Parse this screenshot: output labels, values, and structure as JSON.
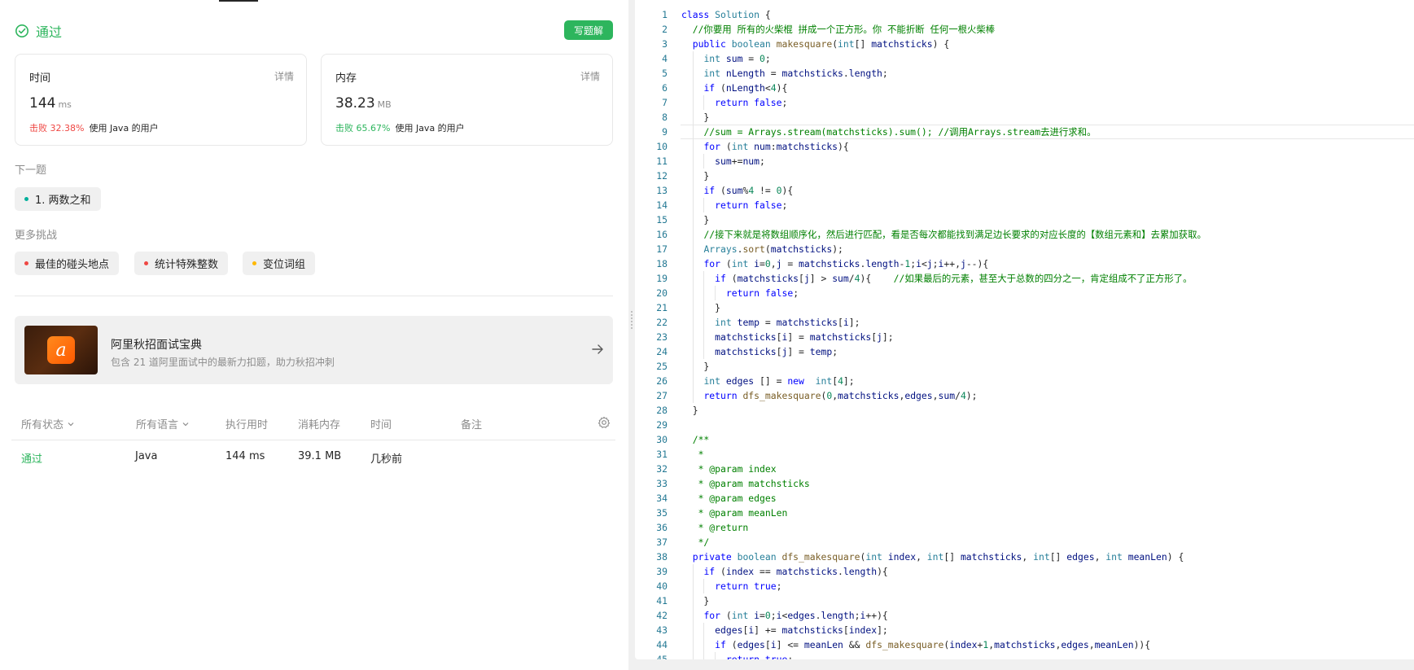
{
  "status": {
    "label": "通过",
    "write_solution": "写题解"
  },
  "cards": {
    "time": {
      "title": "时间",
      "detail": "详情",
      "value": "144",
      "unit": "ms",
      "beat": "击败 32.38%",
      "beat_suffix": "使用 Java 的用户"
    },
    "memory": {
      "title": "内存",
      "detail": "详情",
      "value": "38.23",
      "unit": "MB",
      "beat": "击败 65.67%",
      "beat_suffix": "使用 Java 的用户"
    }
  },
  "next": {
    "label": "下一题",
    "item": "1. 两数之和",
    "dot_color": "#00af9b"
  },
  "more": {
    "label": "更多挑战",
    "items": [
      {
        "label": "最佳的碰头地点",
        "dot_color": "#ef4743"
      },
      {
        "label": "统计特殊整数",
        "dot_color": "#ef4743"
      },
      {
        "label": "变位词组",
        "dot_color": "#ffb800"
      }
    ]
  },
  "promo": {
    "title": "阿里秋招面试宝典",
    "desc": "包含 21 道阿里面试中的最新力扣题，助力秋招冲刺"
  },
  "table": {
    "headers": [
      "所有状态",
      "所有语言",
      "执行用时",
      "消耗内存",
      "时间",
      "备注"
    ],
    "rows": [
      {
        "status": "通过",
        "lang": "Java",
        "runtime": "144 ms",
        "memory": "39.1 MB",
        "time": "几秒前",
        "note": ""
      }
    ]
  },
  "code_lines": [
    "class Solution {",
    "  //你要用 所有的火柴棍 拼成一个正方形。你 不能折断 任何一根火柴棒",
    "  public boolean makesquare(int[] matchsticks) {",
    "    int sum = 0;",
    "    int nLength = matchsticks.length;",
    "    if (nLength<4){",
    "      return false;",
    "    }",
    "    //sum = Arrays.stream(matchsticks).sum(); //调用Arrays.stream去进行求和。",
    "    for (int num:matchsticks){",
    "      sum+=num;",
    "    }",
    "    if (sum%4 != 0){",
    "      return false;",
    "    }",
    "    //接下来就是将数组顺序化，然后进行匹配，看是否每次都能找到满足边长要求的对应长度的【数组元素和】去累加获取。",
    "    Arrays.sort(matchsticks);",
    "    for (int i=0,j = matchsticks.length-1;i<j;i++,j--){",
    "      if (matchsticks[j] > sum/4){    //如果最后的元素，甚至大于总数的四分之一，肯定组成不了正方形了。",
    "        return false;",
    "      }",
    "      int temp = matchsticks[i];",
    "      matchsticks[i] = matchsticks[j];",
    "      matchsticks[j] = temp;",
    "    }",
    "    int edges [] = new  int[4];",
    "    return dfs_makesquare(0,matchsticks,edges,sum/4);",
    "  }",
    "",
    "  /**",
    "   *",
    "   * @param index",
    "   * @param matchsticks",
    "   * @param edges",
    "   * @param meanLen",
    "   * @return",
    "   */",
    "  private boolean dfs_makesquare(int index, int[] matchsticks, int[] edges, int meanLen) {",
    "    if (index == matchsticks.length){",
    "      return true;",
    "    }",
    "    for (int i=0;i<edges.length;i++){",
    "      edges[i] += matchsticks[index];",
    "      if (edges[i] <= meanLen && dfs_makesquare(index+1,matchsticks,edges,meanLen)){",
    "        return true;"
  ],
  "current_line": 9,
  "colors": {
    "accent": "#2db55d",
    "red": "#ef4743",
    "line_number": "#237893",
    "keyword": "#0000ff",
    "comment": "#008000"
  }
}
